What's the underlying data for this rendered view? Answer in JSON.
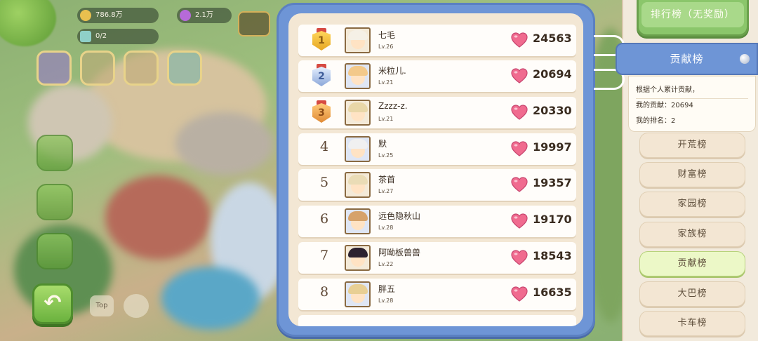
{
  "hud": {
    "coins": "786.8万",
    "gems": "2.1万",
    "cards": "0/2",
    "top_label": "Top"
  },
  "board": {
    "rows": [
      {
        "rank": "1",
        "medal": "gold",
        "name": "七毛",
        "level": "Lv.26",
        "score": "24563"
      },
      {
        "rank": "2",
        "medal": "silver",
        "name": "米粒儿.",
        "level": "Lv.21",
        "score": "20694"
      },
      {
        "rank": "3",
        "medal": "bronze",
        "name": "Zzzz-z.",
        "level": "Lv.21",
        "score": "20330"
      },
      {
        "rank": "4",
        "medal": "",
        "name": "默",
        "level": "Lv.25",
        "score": "19997"
      },
      {
        "rank": "5",
        "medal": "",
        "name": "茶首",
        "level": "Lv.27",
        "score": "19357"
      },
      {
        "rank": "6",
        "medal": "",
        "name": "远色隐秋山",
        "level": "Lv.28",
        "score": "19170"
      },
      {
        "rank": "7",
        "medal": "",
        "name": "阿呦板兽兽",
        "level": "Lv.22",
        "score": "18543"
      },
      {
        "rank": "8",
        "medal": "",
        "name": "胖五",
        "level": "Lv.28",
        "score": "16635"
      }
    ]
  },
  "sidebar": {
    "header": "排行榜（无奖励）",
    "active_tab": "贡献榜",
    "info_desc": "根据个人累计贡献，",
    "my_contrib_label": "我的贡献：",
    "my_contrib": "20694",
    "my_rank_label": "我的排名：",
    "my_rank": "2",
    "categories": [
      "开荒榜",
      "财富榜",
      "家园榜",
      "家族榜",
      "贡献榜",
      "大巴榜",
      "卡车榜"
    ],
    "selected_category": "贡献榜"
  },
  "colors": {
    "panel_blue": "#6e95d6",
    "heart_pink": "#f06b8f",
    "selected_green": "#ecf8c7",
    "header_green": "#8bc66b"
  }
}
